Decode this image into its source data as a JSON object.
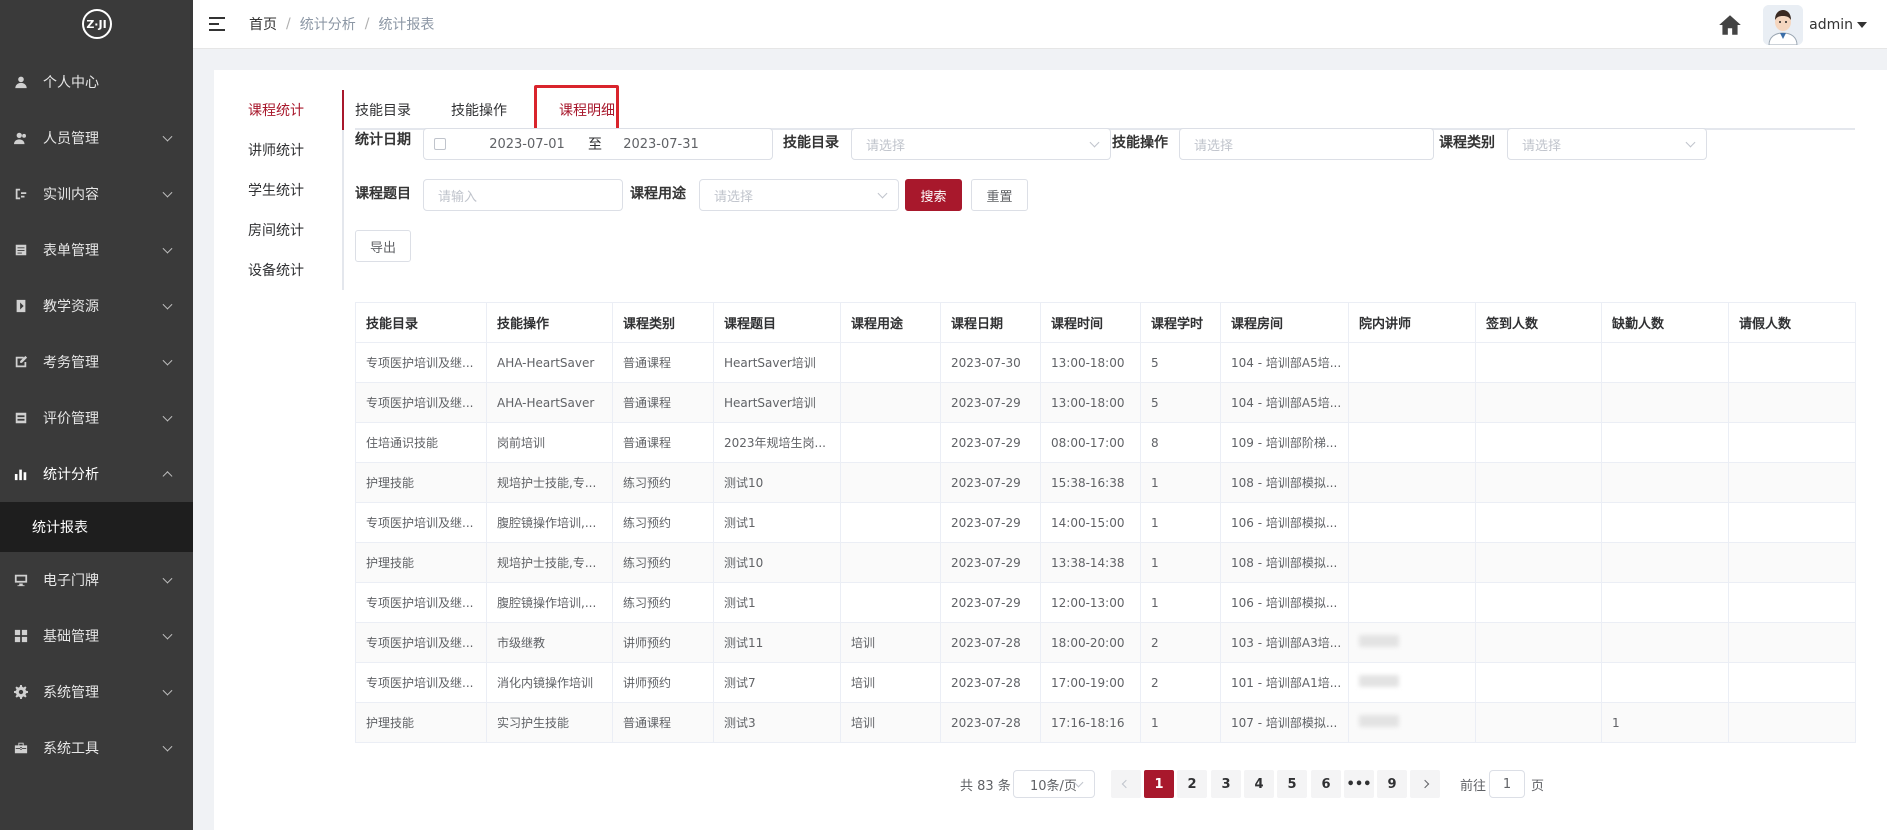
{
  "logo": {
    "text": "Z·JI"
  },
  "sidebar": {
    "items": [
      {
        "label": "个人中心",
        "icon": "user-icon"
      },
      {
        "label": "人员管理",
        "icon": "users-icon"
      },
      {
        "label": "实训内容",
        "icon": "content-icon"
      },
      {
        "label": "表单管理",
        "icon": "form-icon"
      },
      {
        "label": "教学资源",
        "icon": "resource-icon"
      },
      {
        "label": "考务管理",
        "icon": "exam-icon"
      },
      {
        "label": "评价管理",
        "icon": "evaluation-icon"
      },
      {
        "label": "统计分析",
        "icon": "chart-icon"
      },
      {
        "label": "电子门牌",
        "icon": "monitor-icon"
      },
      {
        "label": "基础管理",
        "icon": "grid-icon"
      },
      {
        "label": "系统管理",
        "icon": "gear-icon"
      },
      {
        "label": "系统工具",
        "icon": "toolbox-icon"
      }
    ],
    "active_sub": "统计报表"
  },
  "header": {
    "breadcrumb": [
      "首页",
      "统计分析",
      "统计报表"
    ],
    "user": "admin"
  },
  "side_tabs": [
    "课程统计",
    "讲师统计",
    "学生统计",
    "房间统计",
    "设备统计"
  ],
  "top_tabs": [
    "技能目录",
    "技能操作",
    "课程明细"
  ],
  "filters": {
    "date_label": "统计日期",
    "date_start": "2023-07-01",
    "date_to": "至",
    "date_end": "2023-07-31",
    "skill_dir_label": "技能目录",
    "skill_dir_placeholder": "请选择",
    "skill_op_label": "技能操作",
    "skill_op_placeholder": "请选择",
    "course_type_label": "课程类别",
    "course_type_placeholder": "请选择",
    "course_topic_label": "课程题目",
    "course_topic_placeholder": "请输入",
    "course_use_label": "课程用途",
    "course_use_placeholder": "请选择",
    "search_btn": "搜索",
    "reset_btn": "重置",
    "export_btn": "导出"
  },
  "table": {
    "columns": [
      "技能目录",
      "技能操作",
      "课程类别",
      "课程题目",
      "课程用途",
      "课程日期",
      "课程时间",
      "课程学时",
      "课程房间",
      "院内讲师",
      "签到人数",
      "缺勤人数",
      "请假人数"
    ],
    "rows": [
      [
        "专项医护培训及继...",
        "AHA-HeartSaver",
        "普通课程",
        "HeartSaver培训",
        "",
        "2023-07-30",
        "13:00-18:00",
        "5",
        "104 - 培训部A5培...",
        "",
        "",
        "",
        ""
      ],
      [
        "专项医护培训及继...",
        "AHA-HeartSaver",
        "普通课程",
        "HeartSaver培训",
        "",
        "2023-07-29",
        "13:00-18:00",
        "5",
        "104 - 培训部A5培...",
        "",
        "",
        "",
        ""
      ],
      [
        "住培通识技能",
        "岗前培训",
        "普通课程",
        "2023年规培生岗...",
        "",
        "2023-07-29",
        "08:00-17:00",
        "8",
        "109 - 培训部阶梯...",
        "",
        "",
        "",
        ""
      ],
      [
        "护理技能",
        "规培护士技能,专...",
        "练习预约",
        "测试10",
        "",
        "2023-07-29",
        "15:38-16:38",
        "1",
        "108 - 培训部模拟...",
        "",
        "",
        "",
        ""
      ],
      [
        "专项医护培训及继...",
        "腹腔镜操作培训,...",
        "练习预约",
        "测试1",
        "",
        "2023-07-29",
        "14:00-15:00",
        "1",
        "106 - 培训部模拟...",
        "",
        "",
        "",
        ""
      ],
      [
        "护理技能",
        "规培护士技能,专...",
        "练习预约",
        "测试10",
        "",
        "2023-07-29",
        "13:38-14:38",
        "1",
        "108 - 培训部模拟...",
        "",
        "",
        "",
        ""
      ],
      [
        "专项医护培训及继...",
        "腹腔镜操作培训,...",
        "练习预约",
        "测试1",
        "",
        "2023-07-29",
        "12:00-13:00",
        "1",
        "106 - 培训部模拟...",
        "",
        "",
        "",
        ""
      ],
      [
        "专项医护培训及继...",
        "市级继教",
        "讲师预约",
        "测试11",
        "培训",
        "2023-07-28",
        "18:00-20:00",
        "2",
        "103 - 培训部A3培...",
        "blurred",
        "",
        "",
        ""
      ],
      [
        "专项医护培训及继...",
        "消化内镜操作培训",
        "讲师预约",
        "测试7",
        "培训",
        "2023-07-28",
        "17:00-19:00",
        "2",
        "101 - 培训部A1培...",
        "blurred",
        "",
        "",
        ""
      ],
      [
        "护理技能",
        "实习护生技能",
        "普通课程",
        "测试3",
        "培训",
        "2023-07-28",
        "17:16-18:16",
        "1",
        "107 - 培训部模拟...",
        "blurred",
        "",
        "1",
        ""
      ]
    ]
  },
  "pagination": {
    "total": "共 83 条",
    "page_size": "10条/页",
    "pages": [
      "1",
      "2",
      "3",
      "4",
      "5",
      "6",
      "•••",
      "9"
    ],
    "current": 1,
    "goto_label": "前往",
    "goto_value": "1",
    "page_suffix": "页"
  },
  "colors": {
    "accent": "#a8182c",
    "sidebar_bg": "#3a3a3a",
    "sidebar_active_bg": "#1e1e1e"
  }
}
